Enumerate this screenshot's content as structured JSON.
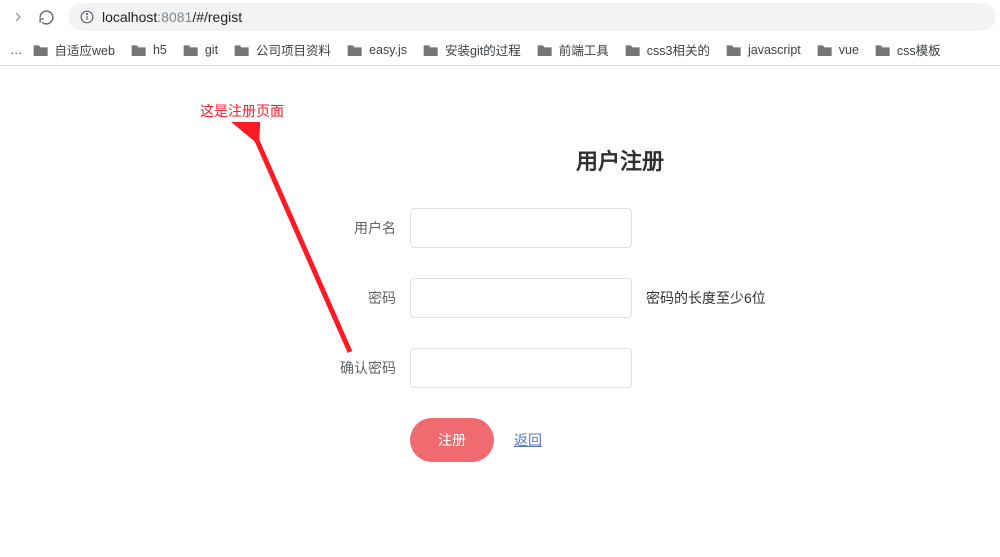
{
  "browser": {
    "url_host": "localhost",
    "url_port": ":8081",
    "url_path": "/#/regist"
  },
  "bookmarks": [
    "自适应web",
    "h5",
    "git",
    "公司项目资料",
    "easy.js",
    "安装git的过程",
    "前端工具",
    "css3相关的",
    "javascript",
    "vue",
    "css模板"
  ],
  "annotation": {
    "text": "这是注册页面"
  },
  "form": {
    "title": "用户注册",
    "username_label": "用户名",
    "username_value": "",
    "password_label": "密码",
    "password_value": "",
    "password_hint": "密码的长度至少6位",
    "confirm_label": "确认密码",
    "confirm_value": "",
    "submit_label": "注册",
    "back_label": "返回"
  }
}
